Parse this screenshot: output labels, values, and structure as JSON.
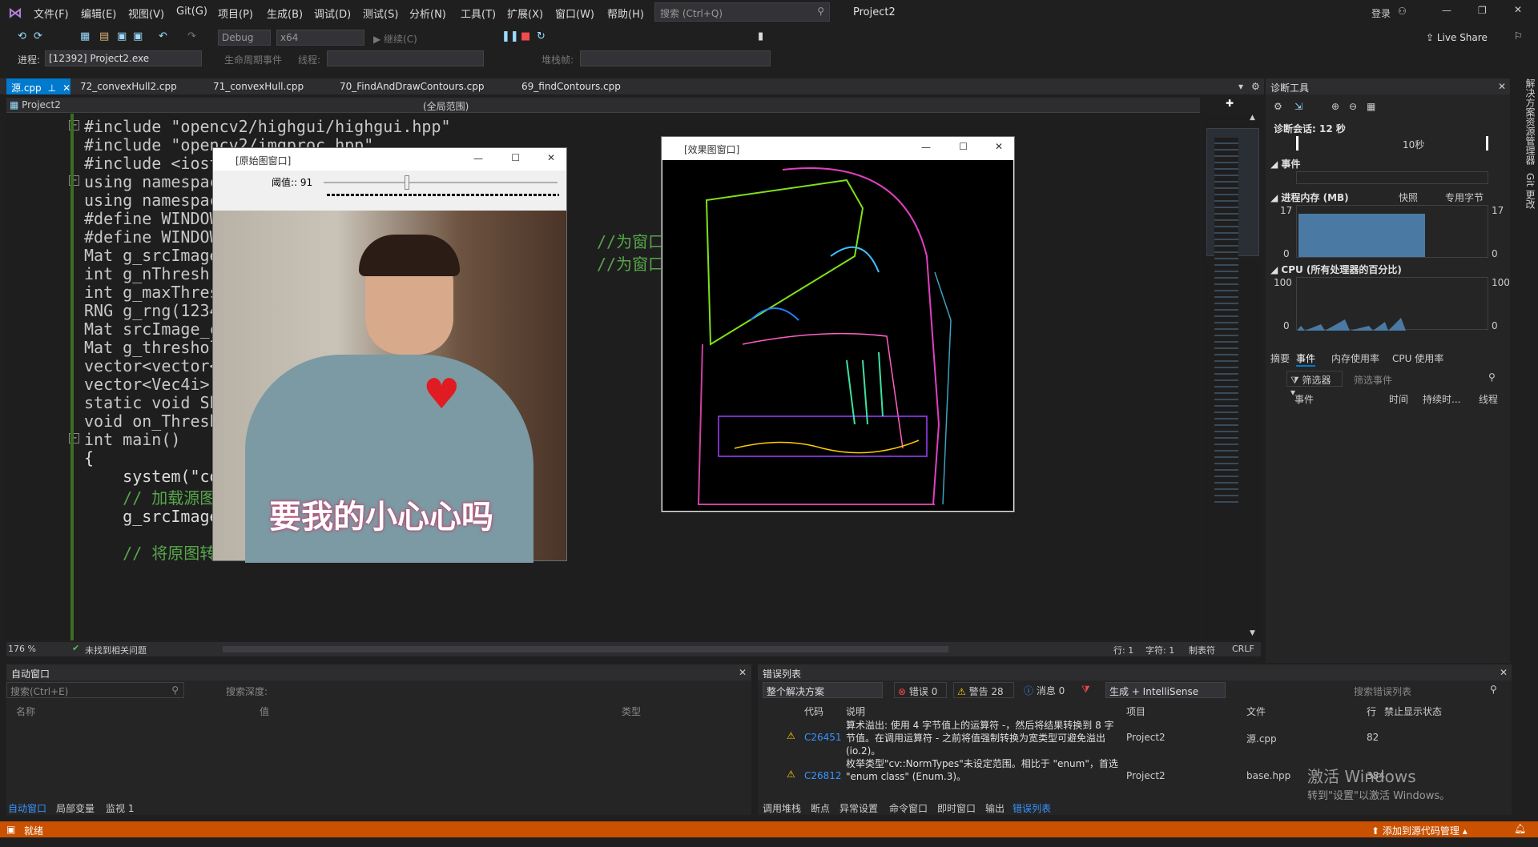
{
  "menu": [
    "文件(F)",
    "编辑(E)",
    "视图(V)",
    "Git(G)",
    "项目(P)",
    "生成(B)",
    "调试(D)",
    "测试(S)",
    "分析(N)",
    "工具(T)",
    "扩展(X)",
    "窗口(W)",
    "帮助(H)"
  ],
  "search_placeholder": "搜索 (Ctrl+Q)",
  "project_title": "Project2",
  "login": "登录",
  "live_share": "Live Share",
  "config": "Debug",
  "platform": "x64",
  "continue": "继续(C)",
  "process_label": "进程:",
  "process_value": "[12392] Project2.exe",
  "lifecycle": "生命周期事件",
  "thread": "线程:",
  "stackframe": "堆栈帧:",
  "tabs": [
    "源.cpp",
    "72_convexHull2.cpp",
    "71_convexHull.cpp",
    "70_FindAndDrawContours.cpp",
    "69_findContours.cpp"
  ],
  "nav_project": "Project2",
  "nav_scope": "(全局范围)",
  "code_lines": [
    "#include \"opencv2/highgui/highgui.hpp\"",
    "#include \"opencv2/imgproc.hpp\"",
    "#include <iost",
    "using namespac",
    "using namespac",
    "#define WINDOW",
    "#define WINDOW",
    "Mat g_srcImage",
    "int g_nThresh",
    "int g_maxThres",
    "RNG g_rng(1234",
    "Mat srcImage_c",
    "Mat g_threshol",
    "vector<vector<",
    "vector<Vec4i>",
    "static void Sh",
    "void on_Thresh",
    "int main()",
    "{",
    "    system(\"co",
    "    // 加载源图像",
    "    g_srcImage = imread(\"孔刘.jpg\", 1);",
    "",
    "    // 将原图转换成灰度图并进行模糊降"
  ],
  "comment1": "//为窗口",
  "comment2": "//为窗口",
  "zoom": "176 %",
  "no_issues": "未找到相关问题",
  "line": "行: 1",
  "char": "字符: 1",
  "tabs_mode": "制表符",
  "eol": "CRLF",
  "orig_window_title": "[原始图窗口]",
  "threshold_label": "阈值:: 91",
  "threshold_value": 91,
  "threshold_max": 255,
  "meme_caption": "要我的小心心吗",
  "result_window_title": "[效果图窗口]",
  "diag": {
    "title": "诊断工具",
    "session": "诊断会话: 12 秒",
    "ten_sec": "10秒",
    "events": "事件",
    "memory": "进程内存 (MB)",
    "snapshot": "快照",
    "private_bytes": "专用字节",
    "mem_max": "17",
    "mem_min": "0",
    "cpu": "CPU (所有处理器的百分比)",
    "cpu_max": "100",
    "cpu_min": "0",
    "tabs": [
      "摘要",
      "事件",
      "内存使用率",
      "CPU 使用率"
    ],
    "filter": "筛选器",
    "filter_events": "筛选事件",
    "cols": [
      "事件",
      "时间",
      "持续时...",
      "线程"
    ]
  },
  "autos": {
    "title": "自动窗口",
    "search": "搜索(Ctrl+E)",
    "depth": "搜索深度:",
    "cols": [
      "名称",
      "值",
      "类型"
    ],
    "bottom_tabs": [
      "自动窗口",
      "局部变量",
      "监视 1"
    ]
  },
  "errors": {
    "title": "错误列表",
    "scope": "整个解决方案",
    "err": "错误 0",
    "warn": "警告 28",
    "msg": "消息 0",
    "build": "生成 + IntelliSense",
    "search": "搜索错误列表",
    "cols": [
      "代码",
      "说明",
      "项目",
      "文件",
      "行",
      "禁止显示状态"
    ],
    "rows": [
      {
        "code": "C26451",
        "desc": "算术溢出: 使用 4 字节值上的运算符 -，然后将结果转换到 8 字节值。在调用运算符 - 之前将值强制转换为宽类型可避免溢出(io.2)。",
        "project": "Project2",
        "file": "源.cpp",
        "line": "82"
      },
      {
        "code": "C26812",
        "desc": "枚举类型\"cv::NormTypes\"未设定范围。相比于 \"enum\"，首选 \"enum class\" (Enum.3)。",
        "project": "Project2",
        "file": "base.hpp",
        "line": "384"
      }
    ],
    "bottom_tabs": [
      "调用堆栈",
      "断点",
      "异常设置",
      "命令窗口",
      "即时窗口",
      "输出",
      "错误列表"
    ]
  },
  "watermark1": "激活 Windows",
  "watermark2": "转到\"设置\"以激活 Windows。",
  "status_ready": "就绪",
  "add_source": "添加到源代码管理",
  "side_tabs": [
    "解决方案资源管理器",
    "Git 更改"
  ],
  "colors": {
    "accent": "#007acc",
    "status": "#ca5100"
  }
}
